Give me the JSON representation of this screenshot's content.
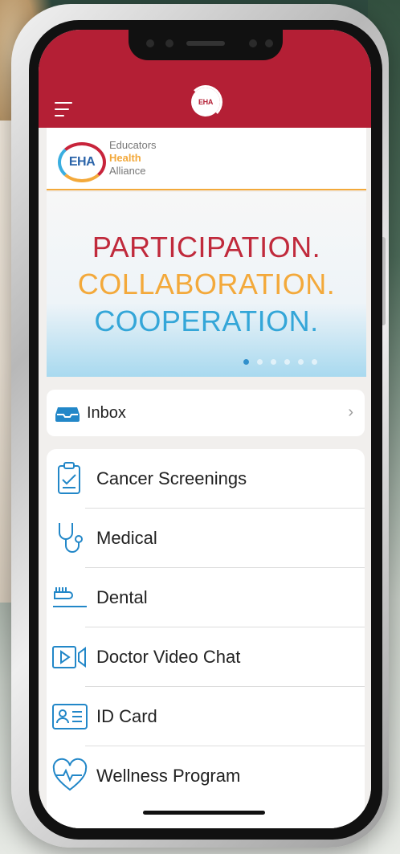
{
  "app": {
    "header_logo_text": "EHA"
  },
  "brand": {
    "logo_text": "EHA",
    "line1": "Educators",
    "line2": "Health",
    "line3": "Alliance"
  },
  "banner": {
    "line1": "PARTICIPATION.",
    "line2": "COLLABORATION.",
    "line3": "COOPERATION.",
    "slide_count": 6,
    "active_slide": 1
  },
  "inbox": {
    "label": "Inbox"
  },
  "menu": {
    "items": [
      {
        "label": "Cancer Screenings",
        "icon": "clipboard-check-icon"
      },
      {
        "label": "Medical",
        "icon": "stethoscope-icon"
      },
      {
        "label": "Dental",
        "icon": "toothbrush-icon"
      },
      {
        "label": "Doctor Video Chat",
        "icon": "video-icon"
      },
      {
        "label": "ID Card",
        "icon": "id-card-icon"
      },
      {
        "label": "Wellness Program",
        "icon": "heart-pulse-icon"
      }
    ]
  },
  "colors": {
    "brand_red": "#b41f35",
    "brand_orange": "#f3a93b",
    "brand_blue": "#34a6d8",
    "icon_blue": "#2287c8"
  }
}
